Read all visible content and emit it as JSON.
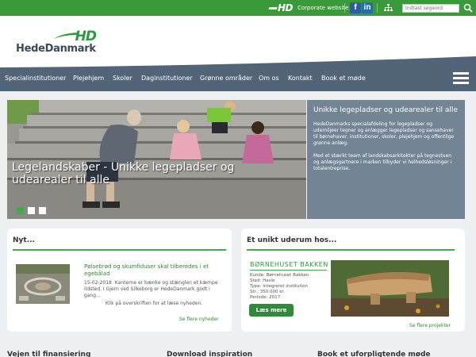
{
  "topbar": {
    "brand_mini": "HD",
    "corporate_link": "Corporate website",
    "facebook": "f",
    "linkedin": "in",
    "search_placeholder": "Indtast søgeord"
  },
  "header": {
    "logo_hd": "HD",
    "logo_name": "HedeDanmark"
  },
  "nav": {
    "items": [
      "Specialinstitutioner",
      "Plejehjem",
      "Skoler",
      "Daginstitutioner",
      "Grønne områder",
      "Om os",
      "Kontakt",
      "Book et møde"
    ]
  },
  "hero": {
    "caption": "Legelandskaber - Unikke legepladser og udearealer til alle",
    "slide_count": 3,
    "active_slide": 1,
    "info_title": "Unikke legepladser og udearealer til alle",
    "info_p1": "HedeDanmarks specialafdeling for legepladser og udemiljøer tegner og anlægger legepladser og sansehaver til børnehaver, institutioner, skoler, plejehjem og offentlige grønne anlæg.",
    "info_p2": "Med et stærkt team af landskabsarkitekter på tegnestuen og anlægsgartnere i marken tilbyder vi helhedsløsninger i totalentreprise."
  },
  "news": {
    "heading": "Nyt...",
    "title": "Pølsebrød og skumfiduser skal tilberedes i et egebålad",
    "date": "15-02-2018",
    "excerpt": "Kanterne er bænke og stænglen et kæmpe ildsted. I Gjern ved Silkeborg er HedeDanmark godt i gang...",
    "read_more": "Klik på overskriften for at læse nyheden.",
    "see_more": "Se flere nyheder"
  },
  "project": {
    "heading": "Et unikt uderum hos...",
    "name": "BØRNEHUSET BAKKEN",
    "meta": [
      "Kunde: Børnehuset Bakken",
      "Sted: Hasle",
      "Type: Integreret institution",
      "Str.: 350.000 kr.",
      "Periode: 2017"
    ],
    "button": "Læs mere",
    "see_more": "Se flere projekter"
  },
  "bottom": {
    "col1": "Vejen til finansiering",
    "col2": "Download inspiration",
    "col3": "Book et uforpligtende møde"
  },
  "colors": {
    "green": "#3a9a3a",
    "nav": "#526478",
    "info_panel": "#738494"
  }
}
